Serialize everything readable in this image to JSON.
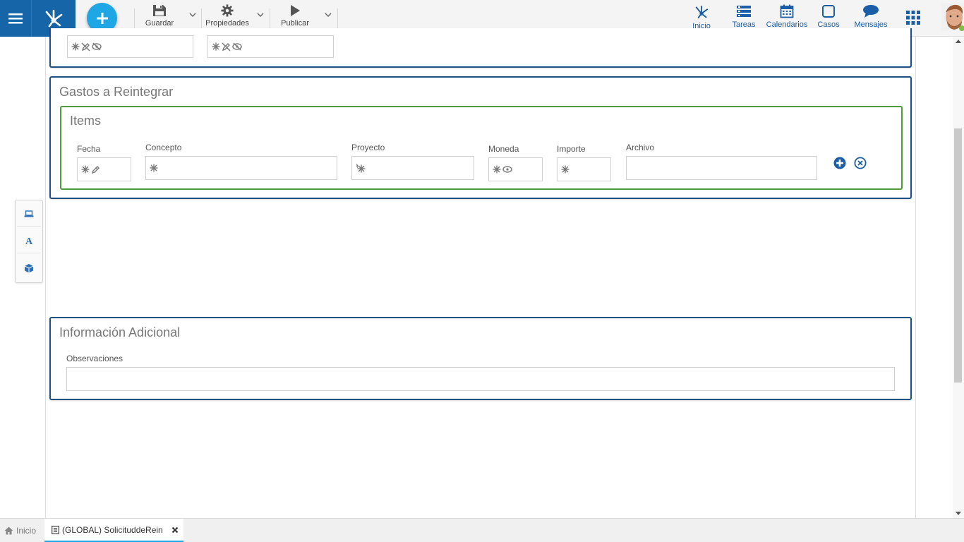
{
  "toolbar": {
    "save_label": "Guardar",
    "properties_label": "Propiedades",
    "publish_label": "Publicar"
  },
  "nav": {
    "home": "Inicio",
    "tasks": "Tareas",
    "calendars": "Calendarios",
    "cases": "Casos",
    "messages": "Mensajes"
  },
  "sections": {
    "gastos": {
      "title": "Gastos a Reintegrar",
      "items": {
        "title": "Items",
        "columns": {
          "fecha": "Fecha",
          "concepto": "Concepto",
          "proyecto": "Proyecto",
          "moneda": "Moneda",
          "importe": "Importe",
          "archivo": "Archivo"
        }
      }
    },
    "info": {
      "title": "Información Adicional",
      "observaciones_label": "Observaciones"
    }
  },
  "tabs": {
    "home": "Inicio",
    "form": "(GLOBAL) SolicituddeRein"
  },
  "colors": {
    "brand_blue": "#1565a8",
    "accent": "#1ea7e4",
    "panel_border": "#1d5183",
    "subpanel_border": "#4e9a3c"
  }
}
